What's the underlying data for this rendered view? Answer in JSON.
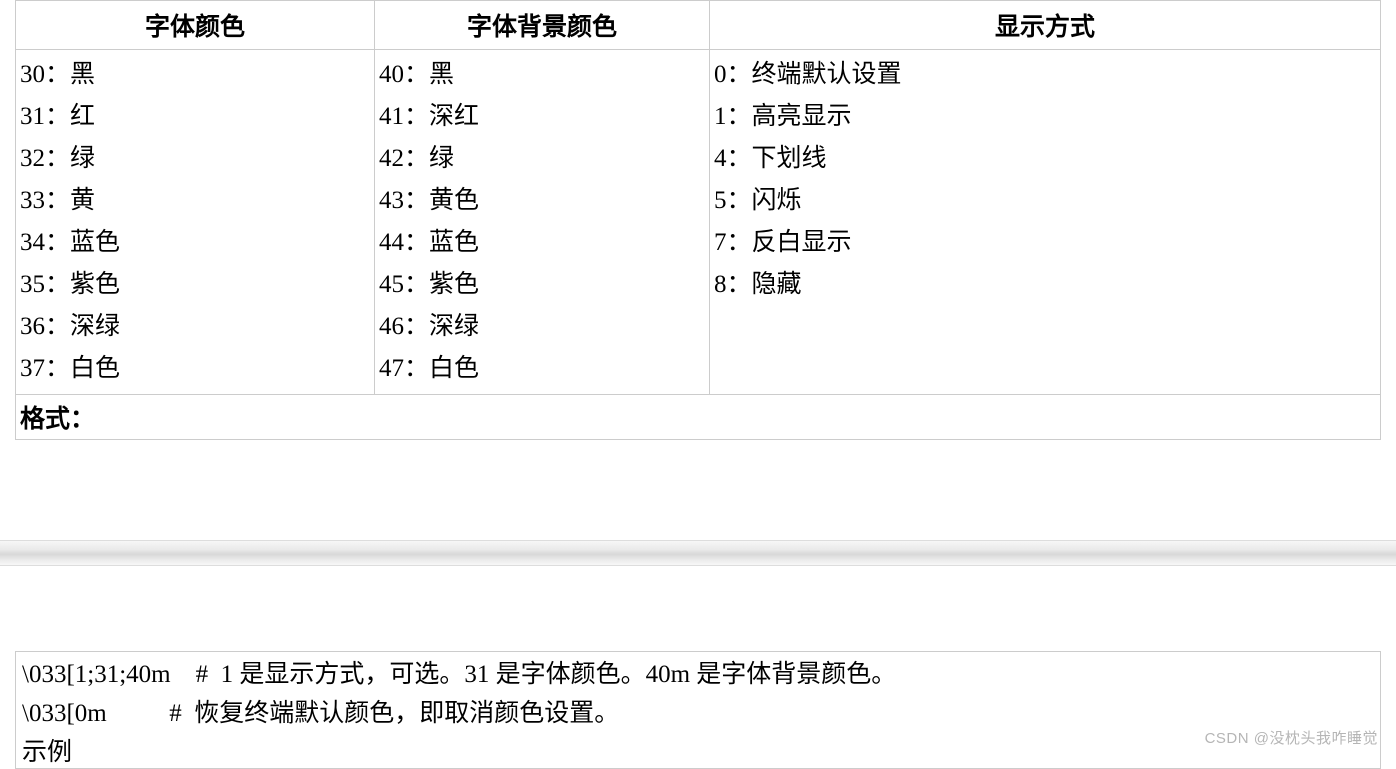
{
  "table": {
    "headers": [
      "字体颜色",
      "字体背景颜色",
      "显示方式"
    ],
    "col1": [
      "30：黑",
      "31：红",
      "32：绿",
      "33：黄",
      "34：蓝色",
      "35：紫色",
      "36：深绿",
      "37：白色"
    ],
    "col2": [
      "40：黑",
      "41：深红",
      "42：绿",
      "43：黄色",
      "44：蓝色",
      "45：紫色",
      "46：深绿",
      "47：白色"
    ],
    "col3": [
      "",
      "0：终端默认设置",
      "1：高亮显示",
      "4：下划线",
      "5：闪烁",
      "7：反白显示",
      "8：隐藏"
    ],
    "footer": "格式："
  },
  "code": {
    "line1": "\\033[1;31;40m    #  1 是显示方式，可选。31 是字体颜色。40m 是字体背景颜色。",
    "line2": "\\033[0m          #  恢复终端默认颜色，即取消颜色设置。"
  },
  "partial": "示例",
  "watermark": "CSDN @没枕头我咋睡觉"
}
